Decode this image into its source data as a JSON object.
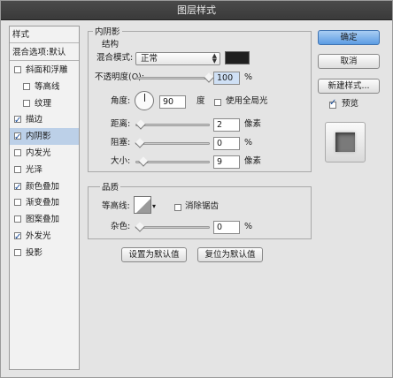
{
  "window": {
    "title": "图层样式"
  },
  "left_panel": {
    "header": "样式",
    "blending_options": "混合选项:默认",
    "items": [
      {
        "label": "斜面和浮雕",
        "checked": false,
        "sub": false,
        "selected": false
      },
      {
        "label": "等高线",
        "checked": false,
        "sub": true,
        "selected": false
      },
      {
        "label": "纹理",
        "checked": false,
        "sub": true,
        "selected": false
      },
      {
        "label": "描边",
        "checked": true,
        "sub": false,
        "selected": false
      },
      {
        "label": "内阴影",
        "checked": true,
        "sub": false,
        "selected": true
      },
      {
        "label": "内发光",
        "checked": false,
        "sub": false,
        "selected": false
      },
      {
        "label": "光泽",
        "checked": false,
        "sub": false,
        "selected": false
      },
      {
        "label": "颜色叠加",
        "checked": true,
        "sub": false,
        "selected": false
      },
      {
        "label": "渐变叠加",
        "checked": false,
        "sub": false,
        "selected": false
      },
      {
        "label": "图案叠加",
        "checked": false,
        "sub": false,
        "selected": false
      },
      {
        "label": "外发光",
        "checked": true,
        "sub": false,
        "selected": false
      },
      {
        "label": "投影",
        "checked": false,
        "sub": false,
        "selected": false
      }
    ]
  },
  "inner_shadow": {
    "section_title": "内阴影",
    "structure_title": "结构",
    "blend_mode_label": "混合模式:",
    "blend_mode_value": "正常",
    "shadow_color": "#1f1f1f",
    "opacity_label": "不透明度(O):",
    "opacity_value": "100",
    "opacity_unit": "%",
    "angle_label": "角度:",
    "angle_value": "90",
    "angle_unit": "度",
    "global_light_label": "使用全局光",
    "global_light_checked": false,
    "distance_label": "距离:",
    "distance_value": "2",
    "distance_unit": "像素",
    "choke_label": "阻塞:",
    "choke_value": "0",
    "choke_unit": "%",
    "size_label": "大小:",
    "size_value": "9",
    "size_unit": "像素"
  },
  "quality": {
    "title": "品质",
    "contour_label": "等高线:",
    "anti_alias_label": "消除锯齿",
    "anti_alias_checked": false,
    "noise_label": "杂色:",
    "noise_value": "0",
    "noise_unit": "%"
  },
  "bottom_buttons": {
    "set_default": "设置为默认值",
    "reset_default": "复位为默认值"
  },
  "right_panel": {
    "ok": "确定",
    "cancel": "取消",
    "new_style": "新建样式...",
    "preview_label": "预览",
    "preview_checked": true
  }
}
